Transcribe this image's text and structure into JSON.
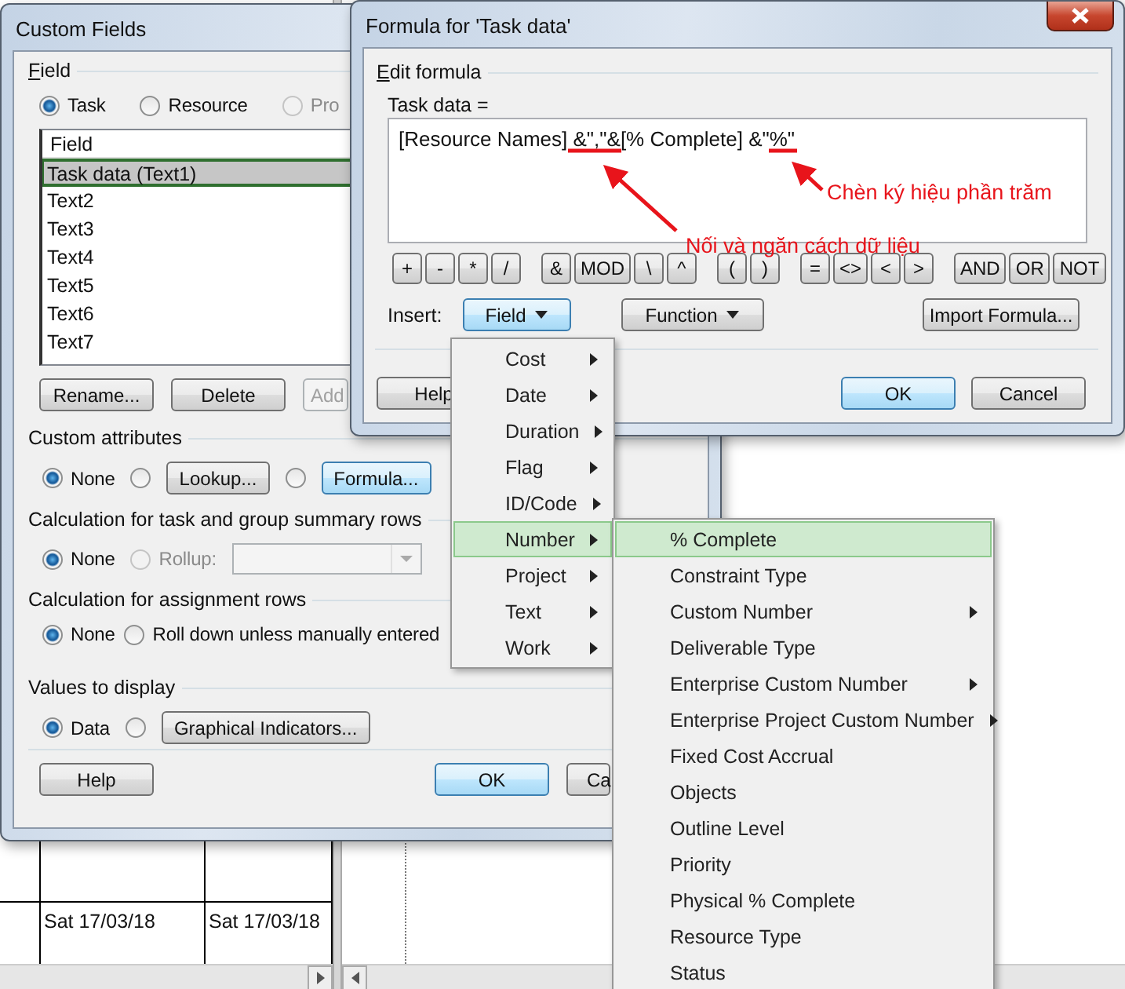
{
  "background_table": {
    "cells": [
      "Sat 17/03/18",
      "Sat 17/03/18"
    ]
  },
  "custom_fields_dialog": {
    "title": "Custom Fields",
    "field_section": {
      "label": "Field",
      "type_options": [
        {
          "label": "Task",
          "selected": true,
          "disabled": false
        },
        {
          "label": "Resource",
          "selected": false,
          "disabled": false
        },
        {
          "label": "Pro",
          "selected": false,
          "disabled": true
        }
      ],
      "list": {
        "header": "Field",
        "items": [
          {
            "label": "Task data (Text1)",
            "selected": true
          },
          {
            "label": "Text2",
            "selected": false
          },
          {
            "label": "Text3",
            "selected": false
          },
          {
            "label": "Text4",
            "selected": false
          },
          {
            "label": "Text5",
            "selected": false
          },
          {
            "label": "Text6",
            "selected": false
          },
          {
            "label": "Text7",
            "selected": false
          }
        ]
      },
      "buttons": [
        {
          "label": "Rename...",
          "disabled": false
        },
        {
          "label": "Delete",
          "disabled": false
        },
        {
          "label": "Add",
          "disabled": true
        }
      ]
    },
    "sections": [
      {
        "label": "Custom attributes",
        "controls": [
          {
            "kind": "radio",
            "label": "None",
            "selected": true,
            "disabled": false
          },
          {
            "kind": "radio",
            "selected": false,
            "disabled": false
          },
          {
            "kind": "button",
            "label": "Lookup...",
            "focused": false,
            "disabled": false
          },
          {
            "kind": "radio",
            "selected": false,
            "disabled": false
          },
          {
            "kind": "button",
            "label": "Formula...",
            "focused": true,
            "disabled": false
          }
        ]
      },
      {
        "label": "Calculation for task and group summary rows",
        "controls": [
          {
            "kind": "radio",
            "label": "None",
            "selected": true,
            "disabled": false
          },
          {
            "kind": "radio",
            "label": "Rollup:",
            "selected": false,
            "disabled": true
          },
          {
            "kind": "dropdown",
            "disabled": true
          }
        ]
      },
      {
        "label": "Calculation for assignment rows",
        "controls": [
          {
            "kind": "radio",
            "label": "None",
            "selected": true,
            "disabled": false
          },
          {
            "kind": "radio",
            "label": "Roll down unless manually entered",
            "selected": false,
            "disabled": false
          }
        ]
      },
      {
        "label": "Values to display",
        "controls": [
          {
            "kind": "radio",
            "label": "Data",
            "selected": true,
            "disabled": false
          },
          {
            "kind": "radio",
            "selected": false,
            "disabled": false
          },
          {
            "kind": "button",
            "label": "Graphical Indicators...",
            "focused": false,
            "disabled": false
          }
        ]
      }
    ],
    "footer_buttons": [
      {
        "label": "Help",
        "default": false
      },
      {
        "label": "OK",
        "default": true
      },
      {
        "label": "Ca",
        "default": false
      }
    ]
  },
  "formula_dialog": {
    "title": "Formula for 'Task data'",
    "group_label": "Edit formula",
    "expression_label": "Task data =",
    "expression": "[Resource Names] &\",\"&[% Complete] &\"%\"",
    "operator_groups": [
      [
        "+",
        "-",
        "*",
        "/"
      ],
      [
        "&",
        "MOD",
        "\\",
        "^"
      ],
      [
        "(",
        ")"
      ],
      [
        "=",
        "<>",
        "<",
        ">"
      ],
      [
        "AND",
        "OR",
        "NOT"
      ]
    ],
    "insert_label": "Insert:",
    "insert_buttons": [
      {
        "label": "Field",
        "dropdown": true,
        "active": true
      },
      {
        "label": "Function",
        "dropdown": true,
        "active": false
      },
      {
        "label": "Import Formula...",
        "dropdown": false,
        "active": false
      }
    ],
    "footer_buttons": [
      {
        "label": "Help",
        "default": false
      },
      {
        "label": "OK",
        "default": true
      },
      {
        "label": "Cancel",
        "default": false
      }
    ]
  },
  "field_menu": {
    "items": [
      {
        "label": "Cost",
        "selected": false
      },
      {
        "label": "Date",
        "selected": false
      },
      {
        "label": "Duration",
        "selected": false
      },
      {
        "label": "Flag",
        "selected": false
      },
      {
        "label": "ID/Code",
        "selected": false
      },
      {
        "label": "Number",
        "selected": true
      },
      {
        "label": "Project",
        "selected": false
      },
      {
        "label": "Text",
        "selected": false
      },
      {
        "label": "Work",
        "selected": false
      }
    ]
  },
  "number_submenu": {
    "items": [
      {
        "label": "% Complete",
        "selected": true,
        "has_submenu": false
      },
      {
        "label": "Constraint Type",
        "selected": false,
        "has_submenu": false
      },
      {
        "label": "Custom Number",
        "selected": false,
        "has_submenu": true
      },
      {
        "label": "Deliverable Type",
        "selected": false,
        "has_submenu": false
      },
      {
        "label": "Enterprise Custom Number",
        "selected": false,
        "has_submenu": true
      },
      {
        "label": "Enterprise Project Custom Number",
        "selected": false,
        "has_submenu": true
      },
      {
        "label": "Fixed Cost Accrual",
        "selected": false,
        "has_submenu": false
      },
      {
        "label": "Objects",
        "selected": false,
        "has_submenu": false
      },
      {
        "label": "Outline Level",
        "selected": false,
        "has_submenu": false
      },
      {
        "label": "Priority",
        "selected": false,
        "has_submenu": false
      },
      {
        "label": "Physical % Complete",
        "selected": false,
        "has_submenu": false
      },
      {
        "label": "Resource Type",
        "selected": false,
        "has_submenu": false
      },
      {
        "label": "Status",
        "selected": false,
        "has_submenu": false
      }
    ]
  },
  "annotations": [
    {
      "text": "Nối và ngăn cách dữ liệu"
    },
    {
      "text": "Chèn ký hiệu phần trăm"
    }
  ]
}
